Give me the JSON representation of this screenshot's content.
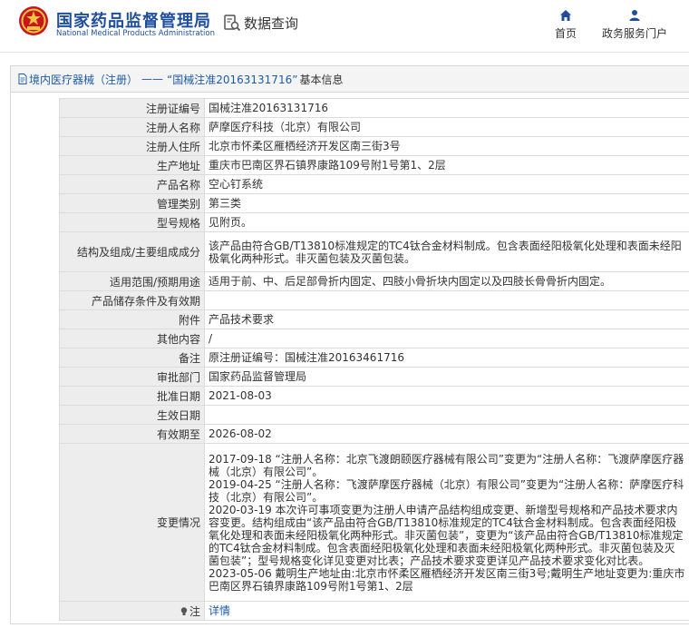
{
  "header": {
    "site_title": "国家药品监督管理局",
    "site_subtitle": "National Medical Products Administration",
    "search_tool_label": "数据查询",
    "nav": [
      {
        "label": "首页",
        "icon": "home-icon"
      },
      {
        "label": "政务服务门户",
        "icon": "user-icon"
      }
    ]
  },
  "breadcrumb": {
    "section": "境内医疗器械（注册）",
    "separator": "——",
    "record_title": "“国械注准20163131716”",
    "suffix": "基本信息"
  },
  "rows": [
    {
      "label": "注册证编号",
      "value": "国械注准20163131716"
    },
    {
      "label": "注册人名称",
      "value": "萨摩医疗科技（北京）有限公司"
    },
    {
      "label": "注册人住所",
      "value": "北京市怀柔区雁栖经济开发区南三街3号"
    },
    {
      "label": "生产地址",
      "value": "重庆市巴南区界石镇界康路109号附1号第1、2层"
    },
    {
      "label": "产品名称",
      "value": "空心钉系统"
    },
    {
      "label": "管理类别",
      "value": "第三类"
    },
    {
      "label": "型号规格",
      "value": "见附页。"
    },
    {
      "label": "结构及组成/主要组成成分",
      "value": "该产品由符合GB/T13810标准规定的TC4钛合金材料制成。包含表面经阳极氧化处理和表面未经阳极氧化两种形式。非灭菌包装及灭菌包装。"
    },
    {
      "label": "适用范围/预期用途",
      "value": "适用于前、中、后足部骨折内固定、四肢小骨折块内固定以及四肢长骨骨折内固定。"
    },
    {
      "label": "产品储存条件及有效期",
      "value": ""
    },
    {
      "label": "附件",
      "value": "产品技术要求"
    },
    {
      "label": "其他内容",
      "value": "/"
    },
    {
      "label": "备注",
      "value": "原注册证编号：国械注准20163461716"
    },
    {
      "label": "审批部门",
      "value": "国家药品监督管理局"
    },
    {
      "label": "批准日期",
      "value": "2021-08-03"
    },
    {
      "label": "生效日期",
      "value": ""
    },
    {
      "label": "有效期至",
      "value": "2026-08-02"
    },
    {
      "label": "变更情况",
      "value": "2017-09-18 “注册人名称：北京飞渡朗颐医疗器械有限公司”变更为“注册人名称：飞渡萨摩医疗器械（北京）有限公司”。\n2019-04-25 “注册人名称：飞渡萨摩医疗器械（北京）有限公司”变更为“注册人名称：萨摩医疗科技（北京）有限公司”。\n2020-03-19 本次许可事项变更为注册人申请产品结构组成变更、新增型号规格和产品技术要求内容变更。结构组成由“该产品由符合GB/T13810标准规定的TC4钛合金材料制成。包含表面经阳极氧化处理和表面未经阳极氧化两种形式。非灭菌包装”，变更为“该产品由符合GB/T13810标准规定的TC4钛合金材料制成。包含表面经阳极氧化处理和表面未经阳极氧化两种形式。非灭菌包装及灭菌包装”；型号规格变化详见变更对比表；产品技术要求变更详见产品技术要求变化对比表。\n2023-05-06 戴明生产地址由:北京市怀柔区雁栖经济开发区南三街3号;戴明生产地址变更为:重庆市巴南区界石镇界康路109号附1号第1、2层"
    },
    {
      "label": "注",
      "value": "详情",
      "icon": "lightbulb-icon"
    }
  ]
}
